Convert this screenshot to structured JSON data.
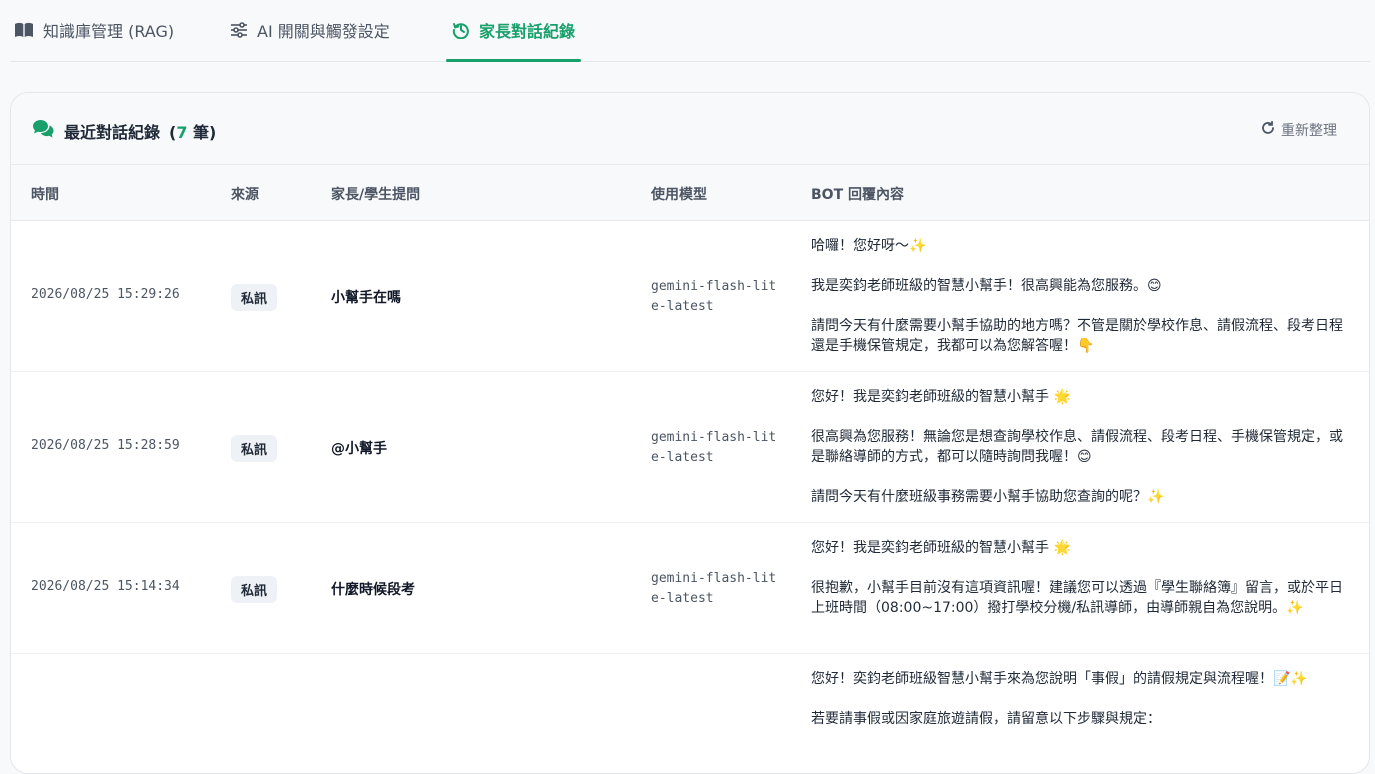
{
  "tabs": [
    {
      "label": "知識庫管理 (RAG)",
      "icon": "book-icon"
    },
    {
      "label": "AI 開關與觸發設定",
      "icon": "sliders-icon"
    },
    {
      "label": "家長對話紀錄",
      "icon": "history-icon"
    }
  ],
  "active_tab": 2,
  "card": {
    "title": "最近對話紀錄",
    "count_open": "(",
    "count": "7",
    "count_unit": "筆)",
    "refresh_label": "重新整理"
  },
  "columns": {
    "time": "時間",
    "source": "來源",
    "question": "家長/學生提問",
    "model": "使用模型",
    "reply": "BOT 回覆內容"
  },
  "rows": [
    {
      "time": "2026/08/25 15:29:26",
      "source": "私訊",
      "question": "小幫手在嗎",
      "model": "gemini-flash-lite-latest",
      "reply": "哈囉！您好呀～✨\n\n我是奕鈞老師班級的智慧小幫手！很高興能為您服務。😊\n\n請問今天有什麼需要小幫手協助的地方嗎？不管是關於學校作息、請假流程、段考日程還是手機保管規定，我都可以為您解答喔！👇"
    },
    {
      "time": "2026/08/25 15:28:59",
      "source": "私訊",
      "question": "@小幫手",
      "model": "gemini-flash-lite-latest",
      "reply": "您好！我是奕鈞老師班級的智慧小幫手 🌟\n\n很高興為您服務！無論您是想查詢學校作息、請假流程、段考日程、手機保管規定，或是聯絡導師的方式，都可以隨時詢問我喔！😊\n\n請問今天有什麼班級事務需要小幫手協助您查詢的呢？✨"
    },
    {
      "time": "2026/08/25 15:14:34",
      "source": "私訊",
      "question": "什麼時候段考",
      "model": "gemini-flash-lite-latest",
      "reply": "您好！我是奕鈞老師班級的智慧小幫手 🌟\n\n很抱歉，小幫手目前沒有這項資訊喔！建議您可以透過『學生聯絡簿』留言，或於平日上班時間（08:00~17:00）撥打學校分機/私訊導師，由導師親自為您說明。✨"
    },
    {
      "time": "",
      "source": "",
      "question": "",
      "model": "",
      "reply": "您好！奕鈞老師班級智慧小幫手來為您說明「事假」的請假規定與流程喔！📝✨\n\n若要請事假或因家庭旅遊請假，請留意以下步驟與規定："
    }
  ],
  "colors": {
    "accent": "#18a06b",
    "text": "#1f2937",
    "muted": "#6b7280"
  }
}
